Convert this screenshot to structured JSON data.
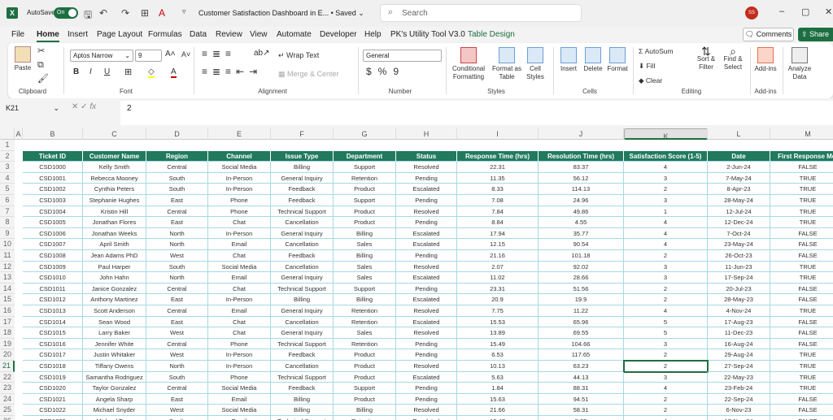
{
  "titlebar": {
    "autosave": "AutoSave",
    "toggle": "On",
    "title": "Customer Satisfaction Dashboard in E...",
    "saved": "• Saved",
    "search_placeholder": "Search",
    "avatar": "SS",
    "logo": "X"
  },
  "tabs": [
    "File",
    "Home",
    "Insert",
    "Page Layout",
    "Formulas",
    "Data",
    "Review",
    "View",
    "Automate",
    "Developer",
    "Help",
    "PK's Utility Tool V3.0",
    "Table Design"
  ],
  "active_tab": "Home",
  "comments": "Comments",
  "share": "Share",
  "ribbon": {
    "paste": "Paste",
    "font_name": "Aptos Narrow",
    "font_size": "9",
    "wrap_text": "Wrap Text",
    "merge_center": "Merge & Center",
    "number_format": "General",
    "conditional_formatting": "Conditional Formatting",
    "format_as_table": "Format as Table",
    "cell_styles": "Cell Styles",
    "insert": "Insert",
    "delete": "Delete",
    "format": "Format",
    "autosum": "AutoSum",
    "fill": "Fill",
    "clear": "Clear",
    "sort_filter": "Sort & Filter",
    "find_select": "Find & Select",
    "addins": "Add-ins",
    "analyze_data": "Analyze Data",
    "groups": {
      "clipboard": "Clipboard",
      "font": "Font",
      "alignment": "Alignment",
      "number": "Number",
      "styles": "Styles",
      "cells": "Cells",
      "editing": "Editing",
      "addins": "Add-ins"
    }
  },
  "formula_bar": {
    "name_box": "K21",
    "value": "2"
  },
  "columns": [
    "A",
    "B",
    "C",
    "D",
    "E",
    "F",
    "G",
    "H",
    "I",
    "J",
    "K",
    "L",
    "M"
  ],
  "selected_column": "K",
  "selected_row": 21,
  "table": {
    "headers": [
      "Ticket ID",
      "Customer Name",
      "Region",
      "Channel",
      "Issue Type",
      "Department",
      "Status",
      "Response Time (hrs)",
      "Resolution Time (hrs)",
      "Satisfaction Score (1-5)",
      "Date",
      "First Response Met"
    ],
    "rows": [
      [
        "CSD1000",
        "Kelly Smith",
        "Central",
        "Social Media",
        "Billing",
        "Support",
        "Resolved",
        "22.31",
        "83.37",
        "4",
        "2-Jun-24",
        "FALSE"
      ],
      [
        "CSD1001",
        "Rebecca Mooney",
        "South",
        "In-Person",
        "General Inquiry",
        "Retention",
        "Pending",
        "11.35",
        "56.12",
        "3",
        "7-May-24",
        "TRUE"
      ],
      [
        "CSD1002",
        "Cynthia Peters",
        "South",
        "In-Person",
        "Feedback",
        "Product",
        "Escalated",
        "8.33",
        "114.13",
        "2",
        "8-Apr-23",
        "TRUE"
      ],
      [
        "CSD1003",
        "Stephanie Hughes",
        "East",
        "Phone",
        "Feedback",
        "Support",
        "Pending",
        "7.08",
        "24.96",
        "3",
        "28-May-24",
        "TRUE"
      ],
      [
        "CSD1004",
        "Kristin Hill",
        "Central",
        "Phone",
        "Technical Support",
        "Product",
        "Resolved",
        "7.84",
        "49.86",
        "1",
        "12-Jul-24",
        "TRUE"
      ],
      [
        "CSD1005",
        "Jonathan Flores",
        "East",
        "Chat",
        "Cancellation",
        "Product",
        "Pending",
        "8.84",
        "4.55",
        "4",
        "12-Dec-24",
        "TRUE"
      ],
      [
        "CSD1006",
        "Jonathan Weeks",
        "North",
        "In-Person",
        "General Inquiry",
        "Billing",
        "Escalated",
        "17.94",
        "35.77",
        "4",
        "7-Oct-24",
        "FALSE"
      ],
      [
        "CSD1007",
        "April Smith",
        "North",
        "Email",
        "Cancellation",
        "Sales",
        "Escalated",
        "12.15",
        "90.54",
        "4",
        "23-May-24",
        "FALSE"
      ],
      [
        "CSD1008",
        "Jean Adams PhD",
        "West",
        "Chat",
        "Feedback",
        "Billing",
        "Pending",
        "21.16",
        "101.18",
        "2",
        "26-Oct-23",
        "FALSE"
      ],
      [
        "CSD1009",
        "Paul Harper",
        "South",
        "Social Media",
        "Cancellation",
        "Sales",
        "Resolved",
        "2.07",
        "92.02",
        "3",
        "11-Jun-23",
        "TRUE"
      ],
      [
        "CSD1010",
        "John Hahn",
        "North",
        "Email",
        "General Inquiry",
        "Sales",
        "Escalated",
        "11.02",
        "28.66",
        "3",
        "17-Sep-24",
        "TRUE"
      ],
      [
        "CSD1011",
        "Janice Gonzalez",
        "Central",
        "Chat",
        "Technical Support",
        "Support",
        "Pending",
        "23.31",
        "51.56",
        "2",
        "20-Jul-23",
        "FALSE"
      ],
      [
        "CSD1012",
        "Anthony Martinez",
        "East",
        "In-Person",
        "Billing",
        "Billing",
        "Escalated",
        "20.9",
        "19.9",
        "2",
        "28-May-23",
        "FALSE"
      ],
      [
        "CSD1013",
        "Scott Anderson",
        "Central",
        "Email",
        "General Inquiry",
        "Retention",
        "Resolved",
        "7.75",
        "11.22",
        "4",
        "4-Nov-24",
        "TRUE"
      ],
      [
        "CSD1014",
        "Sean Wood",
        "East",
        "Chat",
        "Cancellation",
        "Retention",
        "Escalated",
        "15.53",
        "65.96",
        "5",
        "17-Aug-23",
        "FALSE"
      ],
      [
        "CSD1015",
        "Larry Baker",
        "West",
        "Chat",
        "General Inquiry",
        "Sales",
        "Resolved",
        "13.89",
        "69.55",
        "5",
        "11-Dec-23",
        "FALSE"
      ],
      [
        "CSD1016",
        "Jennifer White",
        "Central",
        "Phone",
        "Technical Support",
        "Retention",
        "Pending",
        "15.49",
        "104.66",
        "3",
        "16-Aug-24",
        "FALSE"
      ],
      [
        "CSD1017",
        "Justin Whitaker",
        "West",
        "In-Person",
        "Feedback",
        "Product",
        "Pending",
        "6.53",
        "117.65",
        "2",
        "29-Aug-24",
        "TRUE"
      ],
      [
        "CSD1018",
        "Tiffany Owens",
        "North",
        "In-Person",
        "Cancellation",
        "Product",
        "Resolved",
        "10.13",
        "63.23",
        "2",
        "27-Sep-24",
        "TRUE"
      ],
      [
        "CSD1019",
        "Samantha Rodriguez",
        "South",
        "Phone",
        "Technical Support",
        "Product",
        "Escalated",
        "5.63",
        "44.13",
        "3",
        "22-May-23",
        "TRUE"
      ],
      [
        "CSD1020",
        "Taylor Gonzalez",
        "Central",
        "Social Media",
        "Feedback",
        "Support",
        "Pending",
        "1.84",
        "88.31",
        "4",
        "23-Feb-24",
        "TRUE"
      ],
      [
        "CSD1021",
        "Angela Sharp",
        "East",
        "Email",
        "Billing",
        "Product",
        "Pending",
        "15.63",
        "94.51",
        "2",
        "22-Sep-24",
        "FALSE"
      ],
      [
        "CSD1022",
        "Michael Snyder",
        "West",
        "Social Media",
        "Billing",
        "Billing",
        "Resolved",
        "21.66",
        "58.31",
        "2",
        "6-Nov-23",
        "FALSE"
      ],
      [
        "CSD1023",
        "Michael Terry",
        "South",
        "Email",
        "Technical Support",
        "Retention",
        "Escalated",
        "10.47",
        "5.05",
        "4",
        "17-Nov-24",
        "FALSE"
      ]
    ]
  },
  "colors": {
    "brand": "#1d6f42",
    "table_header": "#217a5e",
    "grid_line": "#a6d9e4"
  }
}
